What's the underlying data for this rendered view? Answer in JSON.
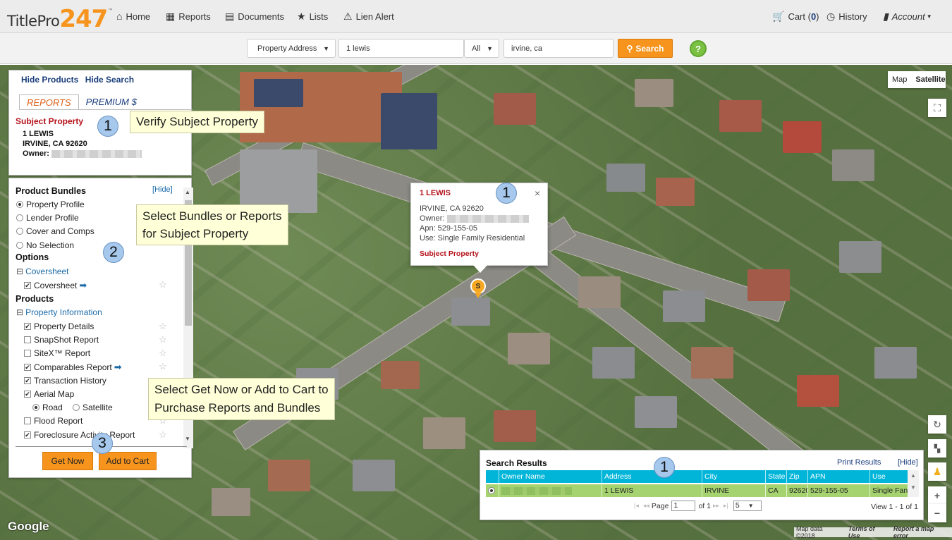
{
  "nav": {
    "logo_text": "TitlePro",
    "logo_number": "247",
    "home": "Home",
    "reports": "Reports",
    "documents": "Documents",
    "lists": "Lists",
    "lien_alert": "Lien Alert",
    "cart_label": "Cart (",
    "cart_count": "0",
    "cart_close": ")",
    "history": "History",
    "account": "Account"
  },
  "search": {
    "type": "Property Address",
    "query": "1 lewis",
    "scope": "All",
    "location": "irvine, ca",
    "button": "Search",
    "help": "?"
  },
  "panel": {
    "hide_products": "Hide Products",
    "hide_search": "Hide Search",
    "tab_reports": "REPORTS",
    "tab_premium": "PREMIUM $",
    "subject_title": "Subject Property",
    "address1": "1 LEWIS",
    "address2": "IRVINE, CA 92620",
    "owner_label": "Owner:",
    "bundles_heading": "Product Bundles",
    "hide": "[Hide]",
    "bundles": [
      "Property Profile",
      "Lender Profile",
      "Cover and Comps",
      "No Selection"
    ],
    "options_heading": "Options",
    "coversheet_group": "Coversheet",
    "coversheet_item": "Coversheet",
    "products_heading": "Products",
    "property_info_group": "Property Information",
    "products": [
      "Property Details",
      "SnapShot Report",
      "SiteX™ Report",
      "Comparables Report",
      "Transaction History",
      "Aerial Map",
      "Flood Report",
      "Foreclosure Activity Report"
    ],
    "aerial_road": "Road",
    "aerial_satellite": "Satellite",
    "get_now": "Get Now",
    "add_to_cart": "Add to Cart"
  },
  "callouts": {
    "verify": "Verify Subject Property",
    "select_bundles_1": "Select Bundles or Reports",
    "select_bundles_2": "for Subject Property",
    "select_get_1": "Select Get Now or Add to Cart to",
    "select_get_2": "Purchase Reports and Bundles",
    "badge1": "1",
    "badge2": "2",
    "badge3": "3"
  },
  "popup": {
    "title": "1 LEWIS",
    "city": "IRVINE, CA 92620",
    "owner": "Owner:",
    "apn": "Apn: 529-155-05",
    "use": "Use: Single Family Residential",
    "subject": "Subject Property",
    "close": "×",
    "marker": "S"
  },
  "map": {
    "map_btn": "Map",
    "satellite_btn": "Satellite",
    "google": "Google",
    "map_data": "Map data ©2018",
    "terms": "Terms of Use",
    "report": "Report a map error"
  },
  "results": {
    "title": "Search Results",
    "print": "Print Results",
    "hide": "[Hide]",
    "columns": [
      "Owner Name",
      "Address",
      "City",
      "State",
      "Zip",
      "APN",
      "Use"
    ],
    "row": [
      "",
      "1 LEWIS",
      "IRVINE",
      "CA",
      "92620",
      "529-155-05",
      "Single Fan"
    ],
    "page_label": "Page",
    "page_value": "1",
    "of_label": "of 1",
    "per_page": "5",
    "view": "View 1 - 1 of 1"
  }
}
